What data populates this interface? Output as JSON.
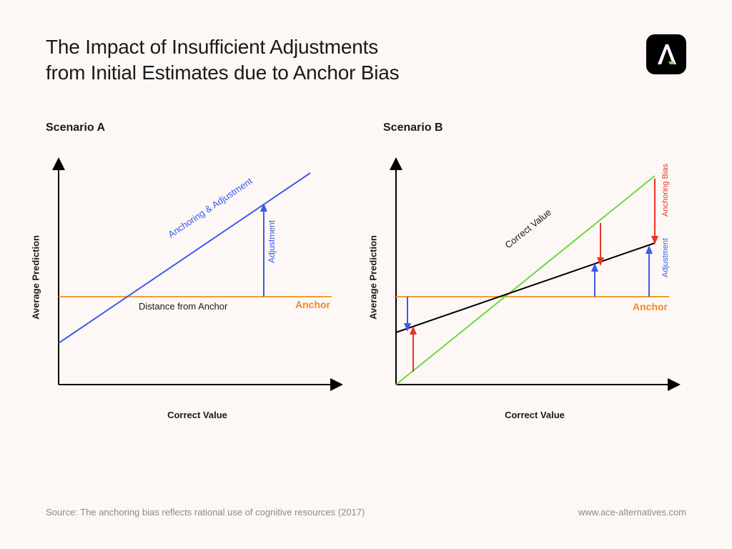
{
  "title_line1": "The Impact of Insufficient Adjustments",
  "title_line2": "from Initial Estimates due to Anchor Bias",
  "logo_letter": "A",
  "scenario_a": {
    "label": "Scenario A",
    "y_axis": "Average Prediction",
    "x_axis": "Correct Value",
    "diag_label": "Anchoring & Adjustment",
    "anchor_label": "Anchor",
    "distance_label": "Distance from Anchor",
    "adjustment_label": "Adjustment"
  },
  "scenario_b": {
    "label": "Scenario B",
    "y_axis": "Average Prediction",
    "x_axis": "Correct Value",
    "correct_label": "Correct Value",
    "anchor_label": "Anchor",
    "adjustment_label": "Adjustment",
    "bias_label": "Anchoring Bias"
  },
  "source": "Source: The anchoring bias reflects rational use of cognitive resources (2017)",
  "website": "www.ace-alternatives.com",
  "chart_data": {
    "type": "line",
    "note": "Conceptual diagram, axes unscaled (no numeric ticks). Coordinates normalized 0..1 on each axis.",
    "anchor_y": 0.42,
    "scenario_a": {
      "anchoring_adjustment_line": {
        "x": [
          0.0,
          0.92
        ],
        "y": [
          0.2,
          0.97
        ]
      },
      "anchor_line": {
        "y": 0.42
      },
      "adjustment_arrow": {
        "x": 0.74,
        "y_from": 0.42,
        "y_to": 0.82
      }
    },
    "scenario_b": {
      "correct_value_line": {
        "x": [
          0.0,
          0.95
        ],
        "y": [
          0.0,
          0.95
        ],
        "color": "green"
      },
      "prediction_line": {
        "x": [
          0.0,
          0.95
        ],
        "y": [
          0.25,
          0.65
        ],
        "color": "black"
      },
      "anchor_line": {
        "y": 0.42,
        "color": "orange"
      },
      "adjustment_arrows": [
        {
          "x": 0.05,
          "y_from": 0.42,
          "y_to": 0.27,
          "color": "blue"
        },
        {
          "x": 0.73,
          "y_from": 0.42,
          "y_to": 0.56,
          "color": "blue"
        },
        {
          "x": 0.93,
          "y_from": 0.42,
          "y_to": 0.64,
          "color": "blue"
        }
      ],
      "bias_arrows": [
        {
          "x": 0.07,
          "y_from": 0.07,
          "y_to": 0.27,
          "color": "red"
        },
        {
          "x": 0.75,
          "y_from": 0.75,
          "y_to": 0.57,
          "color": "red"
        },
        {
          "x": 0.95,
          "y_from": 0.95,
          "y_to": 0.65,
          "color": "red"
        }
      ]
    }
  }
}
